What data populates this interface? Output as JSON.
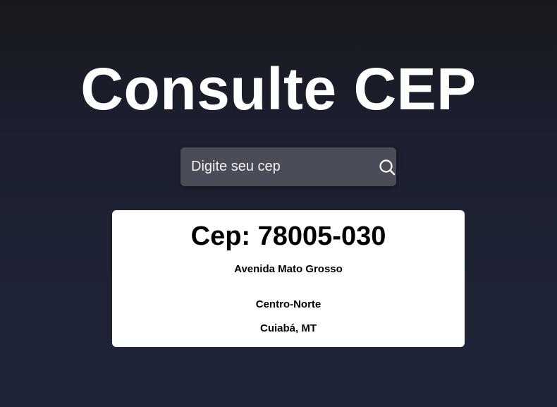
{
  "header": {
    "title": "Consulte CEP"
  },
  "search": {
    "placeholder": "Digite seu cep",
    "value": "",
    "icon": "search-icon"
  },
  "result": {
    "cep_label": "Cep: 78005-030",
    "street": "Avenida Mato Grosso",
    "district": "Centro-Norte",
    "city_state": "Cuiabá, MT"
  },
  "colors": {
    "background_top": "#18191d",
    "background_bottom": "#1f2539",
    "search_box": "#4a4c58",
    "card": "#ffffff",
    "title_text": "#ffffff"
  }
}
